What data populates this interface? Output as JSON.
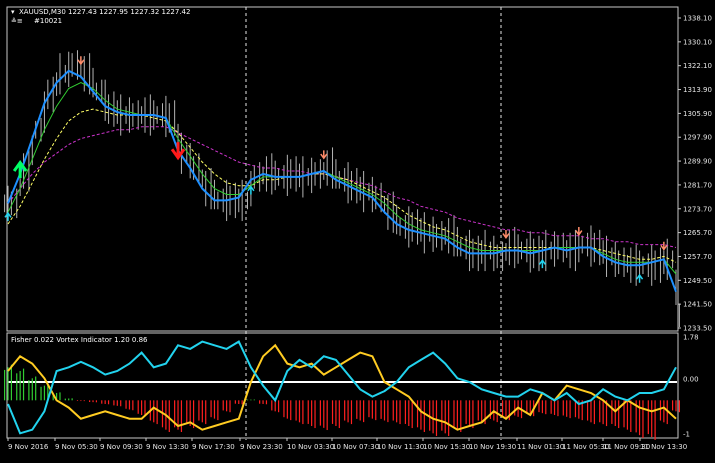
{
  "main_header": {
    "title": "XAUUSD,M30",
    "ohlc": "1227.43 1227.95 1227.32 1227.42",
    "sub_label": "#10021"
  },
  "sub_header": "Fisher 0.022  Vortex Indicator 1.20 0.86",
  "price_ticks": [
    "1338.10",
    "1330.10",
    "1322.10",
    "1313.90",
    "1305.90",
    "1297.90",
    "1289.90",
    "1281.70",
    "1273.70",
    "1265.70",
    "1257.70",
    "1249.50",
    "1241.50",
    "1233.50"
  ],
  "sub_ticks": [
    "1.78",
    "0.00",
    "-1"
  ],
  "time_ticks": [
    "9 Nov 2016",
    "9 Nov 05:30",
    "9 Nov 09:30",
    "9 Nov 13:30",
    "9 Nov 17:30",
    "9 Nov 23:30",
    "10 Nov 03:30",
    "10 Nov 07:30",
    "10 Nov 11:30",
    "10 Nov 15:30",
    "10 Nov 19:30",
    "11 Nov 01:30",
    "11 Nov 05:30",
    "11 Nov 09:30",
    "11 Nov 13:30"
  ],
  "colors": {
    "background": "#000000",
    "bars": "#b4b4b4",
    "fast_ma": "#1e90ff",
    "mid_ma": "#32cd32",
    "slow_ma": "#ffff66",
    "long_ma": "#cc33cc",
    "fisher_pos": "#32cd32",
    "fisher_neg": "#ff2020",
    "vortex_plus": "#22d3ee",
    "vortex_minus": "#ffcc22",
    "arrow_up": "#22d3ee",
    "arrow_down": "#ff8c6a",
    "big_arrow_up": "#00ff66",
    "big_arrow_down": "#ff1a1a"
  },
  "chart_data": [
    {
      "type": "line",
      "title": "XAUUSD,M30",
      "x_labels": [
        "9 Nov 2016",
        "9 Nov 05:30",
        "9 Nov 09:30",
        "9 Nov 13:30",
        "9 Nov 17:30",
        "9 Nov 23:30",
        "10 Nov 03:30",
        "10 Nov 07:30",
        "10 Nov 11:30",
        "10 Nov 15:30",
        "10 Nov 19:30",
        "11 Nov 01:30",
        "11 Nov 05:30",
        "11 Nov 09:30",
        "11 Nov 13:30"
      ],
      "ylim": [
        1232,
        1341
      ],
      "series": [
        {
          "key": "close",
          "values": [
            1275,
            1286,
            1300,
            1312,
            1319,
            1322,
            1319,
            1313,
            1307,
            1305,
            1305,
            1305,
            1305,
            1304,
            1292,
            1287,
            1280,
            1276,
            1276,
            1276,
            1284,
            1285,
            1284,
            1285,
            1284,
            1285,
            1287,
            1283,
            1281,
            1279,
            1277,
            1272,
            1267,
            1267,
            1265,
            1264,
            1264,
            1260,
            1258,
            1259,
            1257,
            1260,
            1259,
            1258,
            1259,
            1260,
            1259,
            1261,
            1260,
            1257,
            1255,
            1254,
            1254,
            1254,
            1256,
            1237
          ]
        },
        {
          "key": "fast_ma",
          "values": [
            1275,
            1285,
            1297,
            1309,
            1316,
            1320,
            1318,
            1313,
            1308,
            1306,
            1305,
            1305,
            1305,
            1304,
            1293,
            1287,
            1280,
            1276,
            1276,
            1277,
            1283,
            1285,
            1284,
            1284,
            1284,
            1285,
            1286,
            1283,
            1281,
            1279,
            1277,
            1272,
            1268,
            1266,
            1265,
            1264,
            1263,
            1260,
            1258,
            1258,
            1258,
            1259,
            1259,
            1258,
            1259,
            1260,
            1259,
            1260,
            1260,
            1257,
            1255,
            1254,
            1254,
            1255,
            1256,
            1245
          ]
        },
        {
          "key": "mid_ma",
          "values": [
            1272,
            1280,
            1290,
            1300,
            1308,
            1314,
            1316,
            1314,
            1310,
            1307,
            1306,
            1305,
            1305,
            1304,
            1297,
            1291,
            1285,
            1280,
            1278,
            1278,
            1281,
            1284,
            1284,
            1284,
            1284,
            1285,
            1286,
            1284,
            1282,
            1280,
            1278,
            1275,
            1271,
            1268,
            1266,
            1265,
            1264,
            1262,
            1260,
            1259,
            1259,
            1259,
            1259,
            1259,
            1259,
            1260,
            1260,
            1260,
            1260,
            1258,
            1256,
            1255,
            1255,
            1255,
            1256,
            1251
          ]
        },
        {
          "key": "slow_ma",
          "values": [
            1268,
            1274,
            1282,
            1290,
            1297,
            1303,
            1306,
            1307,
            1306,
            1305,
            1305,
            1305,
            1304,
            1303,
            1299,
            1294,
            1289,
            1285,
            1282,
            1281,
            1281,
            1283,
            1283,
            1284,
            1284,
            1285,
            1285,
            1284,
            1283,
            1281,
            1279,
            1277,
            1274,
            1271,
            1269,
            1267,
            1266,
            1264,
            1262,
            1261,
            1260,
            1260,
            1260,
            1260,
            1260,
            1260,
            1260,
            1260,
            1260,
            1259,
            1258,
            1257,
            1256,
            1256,
            1257,
            1255
          ]
        },
        {
          "key": "long_ma",
          "values": [
            1275,
            1280,
            1285,
            1289,
            1292,
            1295,
            1297,
            1298,
            1299,
            1300,
            1300,
            1301,
            1301,
            1301,
            1299,
            1297,
            1295,
            1293,
            1291,
            1289,
            1288,
            1287,
            1287,
            1286,
            1286,
            1285,
            1285,
            1284,
            1283,
            1282,
            1281,
            1279,
            1277,
            1276,
            1274,
            1273,
            1272,
            1270,
            1269,
            1268,
            1267,
            1266,
            1266,
            1265,
            1265,
            1264,
            1264,
            1264,
            1263,
            1263,
            1262,
            1262,
            1261,
            1261,
            1261,
            1260
          ]
        }
      ]
    },
    {
      "type": "bar",
      "title": "Fisher 0.022  Vortex Indicator 1.20 0.86",
      "ylim": [
        -1,
        1.78
      ],
      "fisher": [
        0.9,
        0.8,
        0.6,
        0.4,
        0.2,
        0.05,
        -0.02,
        -0.05,
        -0.1,
        -0.15,
        -0.25,
        -0.4,
        -0.6,
        -0.8,
        -0.8,
        -0.7,
        -0.6,
        -0.5,
        -0.3,
        -0.1,
        0.02,
        -0.1,
        -0.3,
        -0.5,
        -0.6,
        -0.7,
        -0.75,
        -0.7,
        -0.6,
        -0.55,
        -0.5,
        -0.55,
        -0.6,
        -0.7,
        -0.8,
        -0.9,
        -0.9,
        -0.8,
        -0.7,
        -0.6,
        -0.55,
        -0.5,
        -0.45,
        -0.4,
        -0.35,
        -0.4,
        -0.45,
        -0.5,
        -0.6,
        -0.65,
        -0.7,
        -0.8,
        -0.95,
        -1.0,
        -0.6,
        -0.3
      ],
      "vortex_plus": [
        -0.1,
        -0.9,
        -0.8,
        -0.3,
        0.8,
        0.9,
        1.05,
        0.9,
        0.7,
        0.8,
        1.0,
        1.3,
        0.9,
        1.0,
        1.5,
        1.4,
        1.6,
        1.5,
        1.4,
        1.6,
        0.9,
        0.4,
        0.0,
        0.8,
        1.1,
        0.9,
        1.2,
        1.1,
        0.7,
        0.3,
        0.1,
        0.25,
        0.5,
        0.9,
        1.1,
        1.3,
        1.0,
        0.6,
        0.5,
        0.3,
        0.2,
        0.1,
        0.1,
        0.3,
        0.2,
        0.0,
        0.2,
        -0.1,
        0.0,
        0.3,
        0.1,
        0.0,
        0.2,
        0.2,
        0.3,
        0.9
      ],
      "vortex_minus": [
        0.8,
        1.2,
        1.0,
        0.6,
        0.0,
        -0.2,
        -0.5,
        -0.4,
        -0.3,
        -0.4,
        -0.5,
        -0.5,
        -0.2,
        -0.4,
        -0.7,
        -0.6,
        -0.8,
        -0.7,
        -0.6,
        -0.5,
        0.5,
        1.2,
        1.5,
        1.0,
        0.9,
        1.0,
        0.7,
        0.9,
        1.1,
        1.3,
        1.2,
        0.5,
        0.3,
        0.1,
        -0.3,
        -0.5,
        -0.6,
        -0.8,
        -0.7,
        -0.6,
        -0.3,
        -0.5,
        -0.2,
        -0.4,
        0.2,
        0.0,
        0.4,
        0.3,
        0.2,
        0.0,
        -0.3,
        0.0,
        -0.2,
        -0.3,
        -0.2,
        -0.5
      ]
    }
  ]
}
